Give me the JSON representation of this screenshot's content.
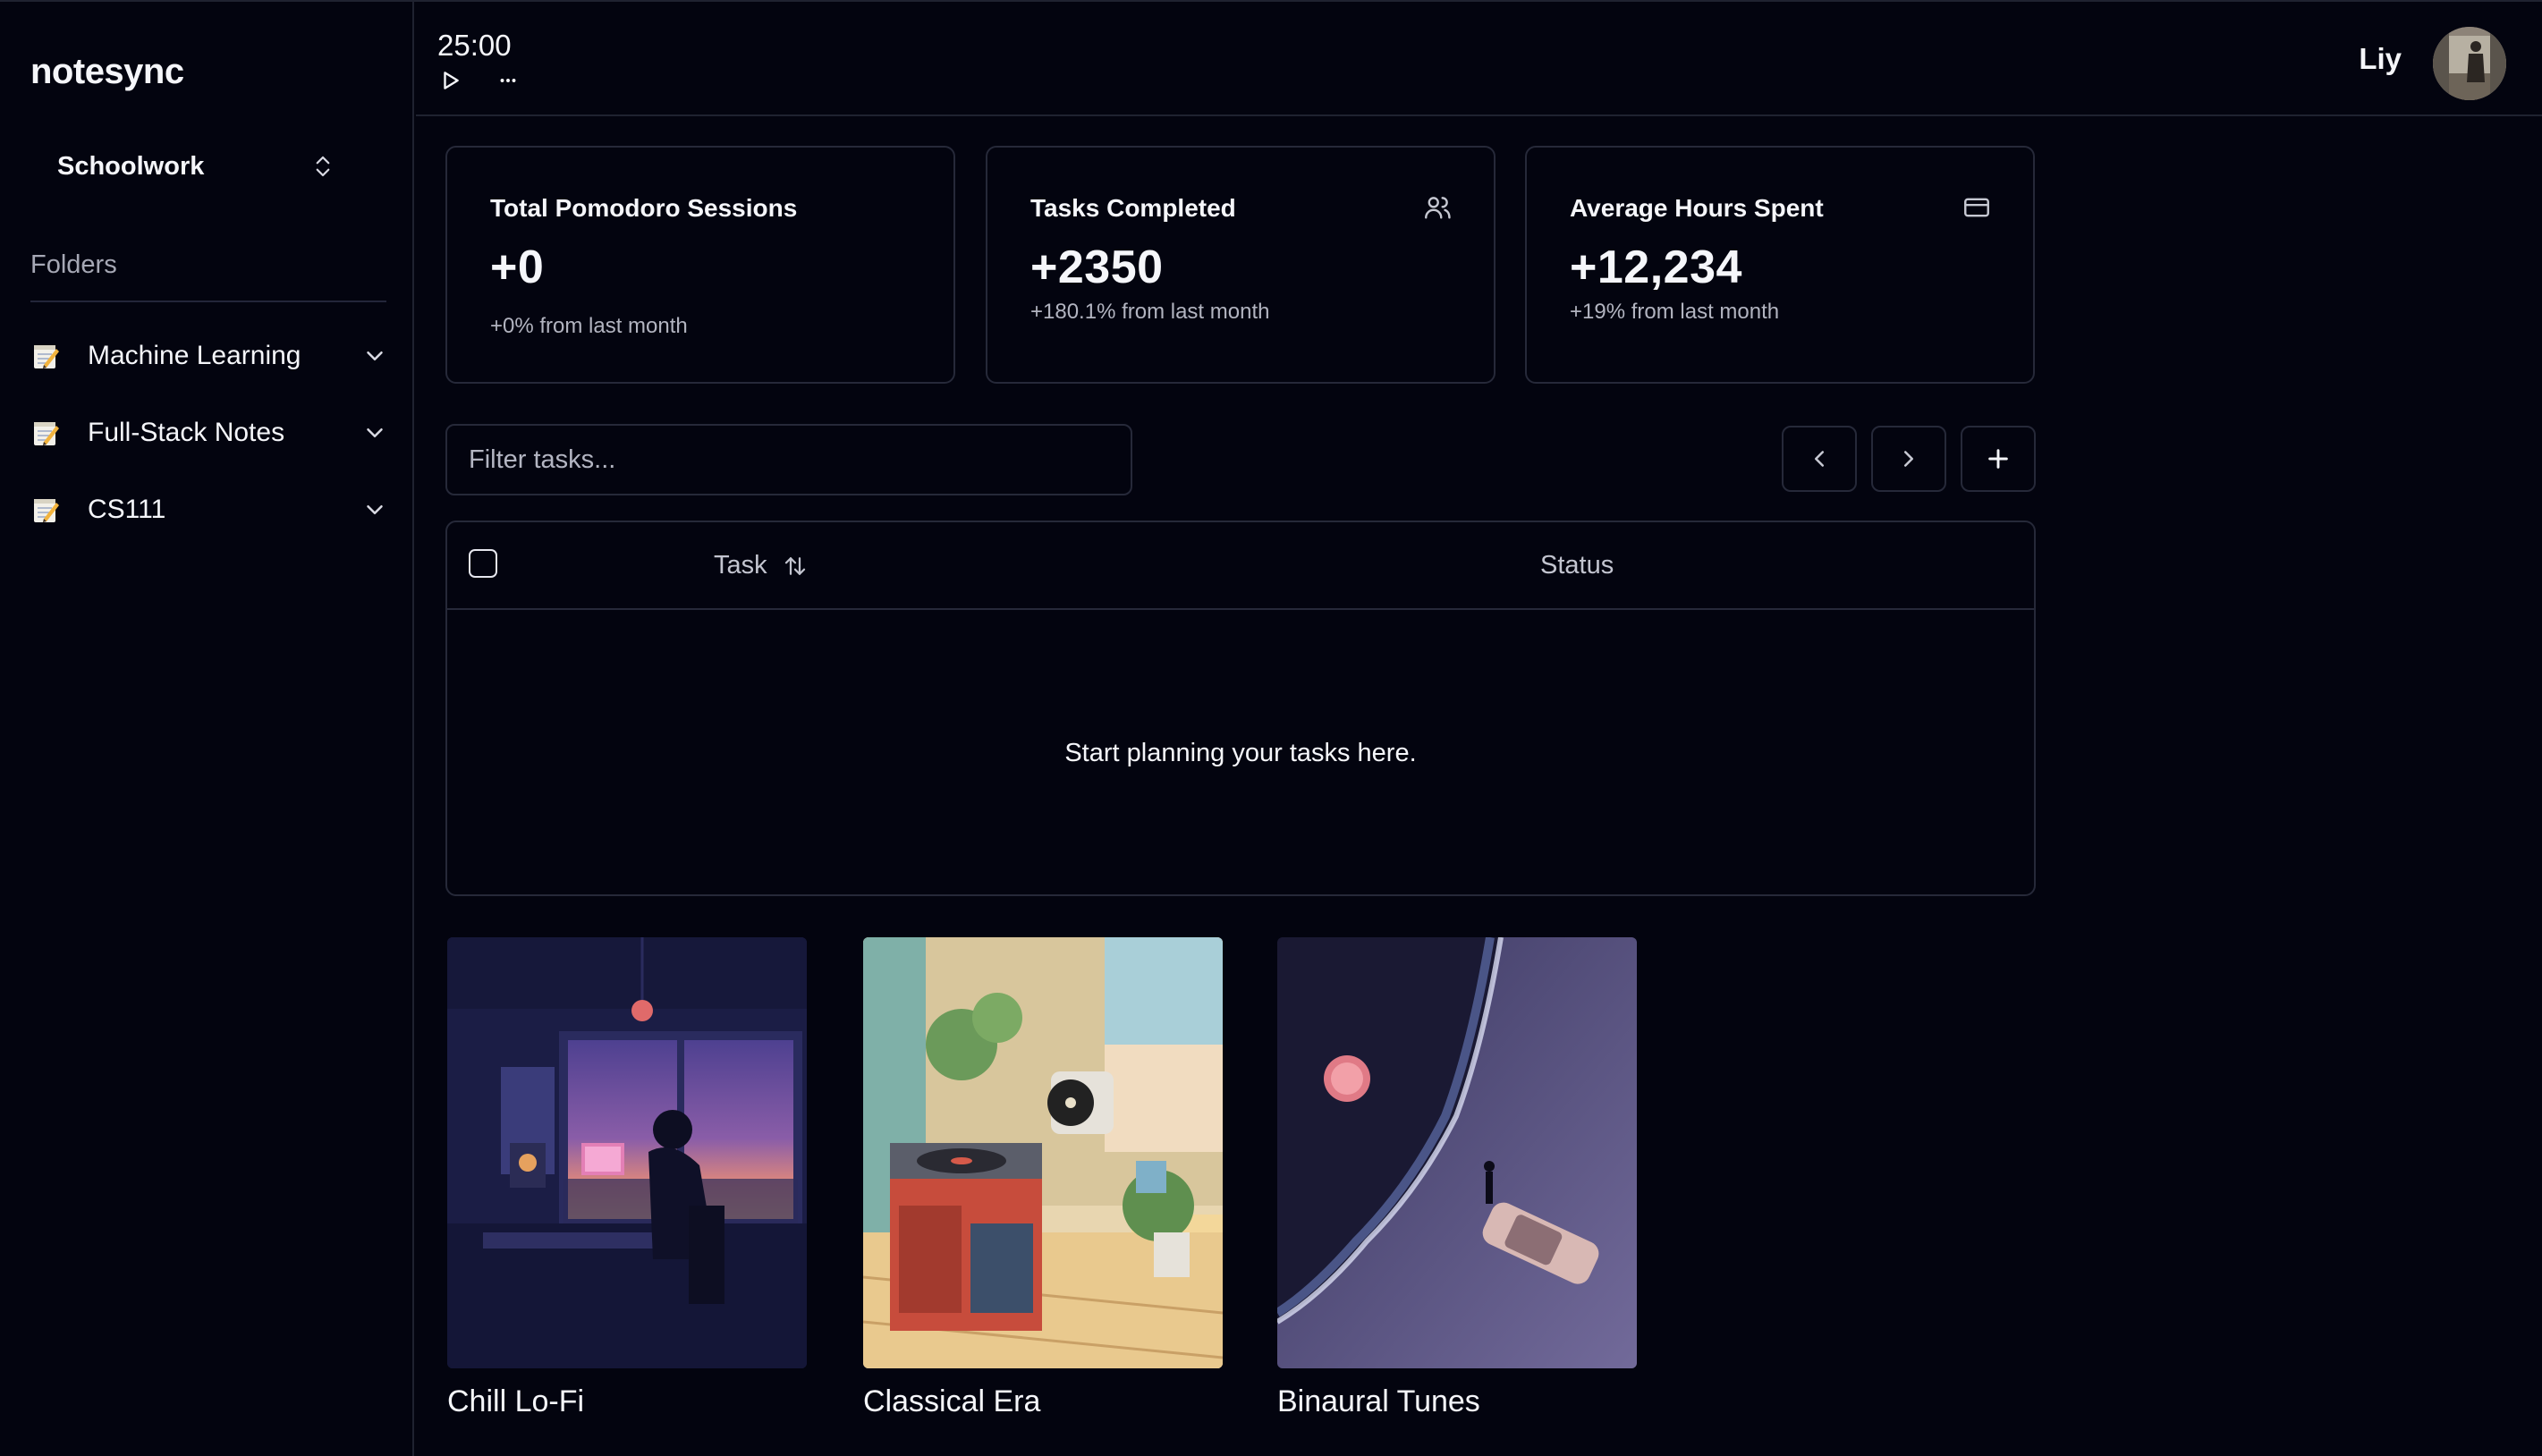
{
  "app": {
    "name": "notesync"
  },
  "sidebar": {
    "workspace": "Schoolwork",
    "folders_label": "Folders",
    "folders": [
      {
        "label": "Machine Learning",
        "icon": "memo-icon"
      },
      {
        "label": "Full-Stack Notes",
        "icon": "memo-icon"
      },
      {
        "label": "CS111",
        "icon": "memo-icon"
      }
    ]
  },
  "header": {
    "timer": "25:00",
    "more_label": "···",
    "user_name": "Liy"
  },
  "stats": [
    {
      "title": "Total Pomodoro Sessions",
      "value": "+0",
      "sub": "+0% from last month",
      "icon": ""
    },
    {
      "title": "Tasks Completed",
      "value": "+2350",
      "sub": "+180.1% from last month",
      "icon": "users-icon"
    },
    {
      "title": "Average Hours Spent",
      "value": "+12,234",
      "sub": "+19% from last month",
      "icon": "credit-card-icon"
    }
  ],
  "tasks": {
    "filter_placeholder": "Filter tasks...",
    "columns": {
      "task": "Task",
      "status": "Status"
    },
    "empty_message": "Start planning your tasks here."
  },
  "playlists": [
    {
      "name": "Chill Lo-Fi"
    },
    {
      "name": "Classical Era"
    },
    {
      "name": "Binaural Tunes"
    }
  ],
  "colors": {
    "background": "#03040f",
    "border": "#262939",
    "text": "#f5f6fa",
    "muted": "#b2b4c0"
  }
}
